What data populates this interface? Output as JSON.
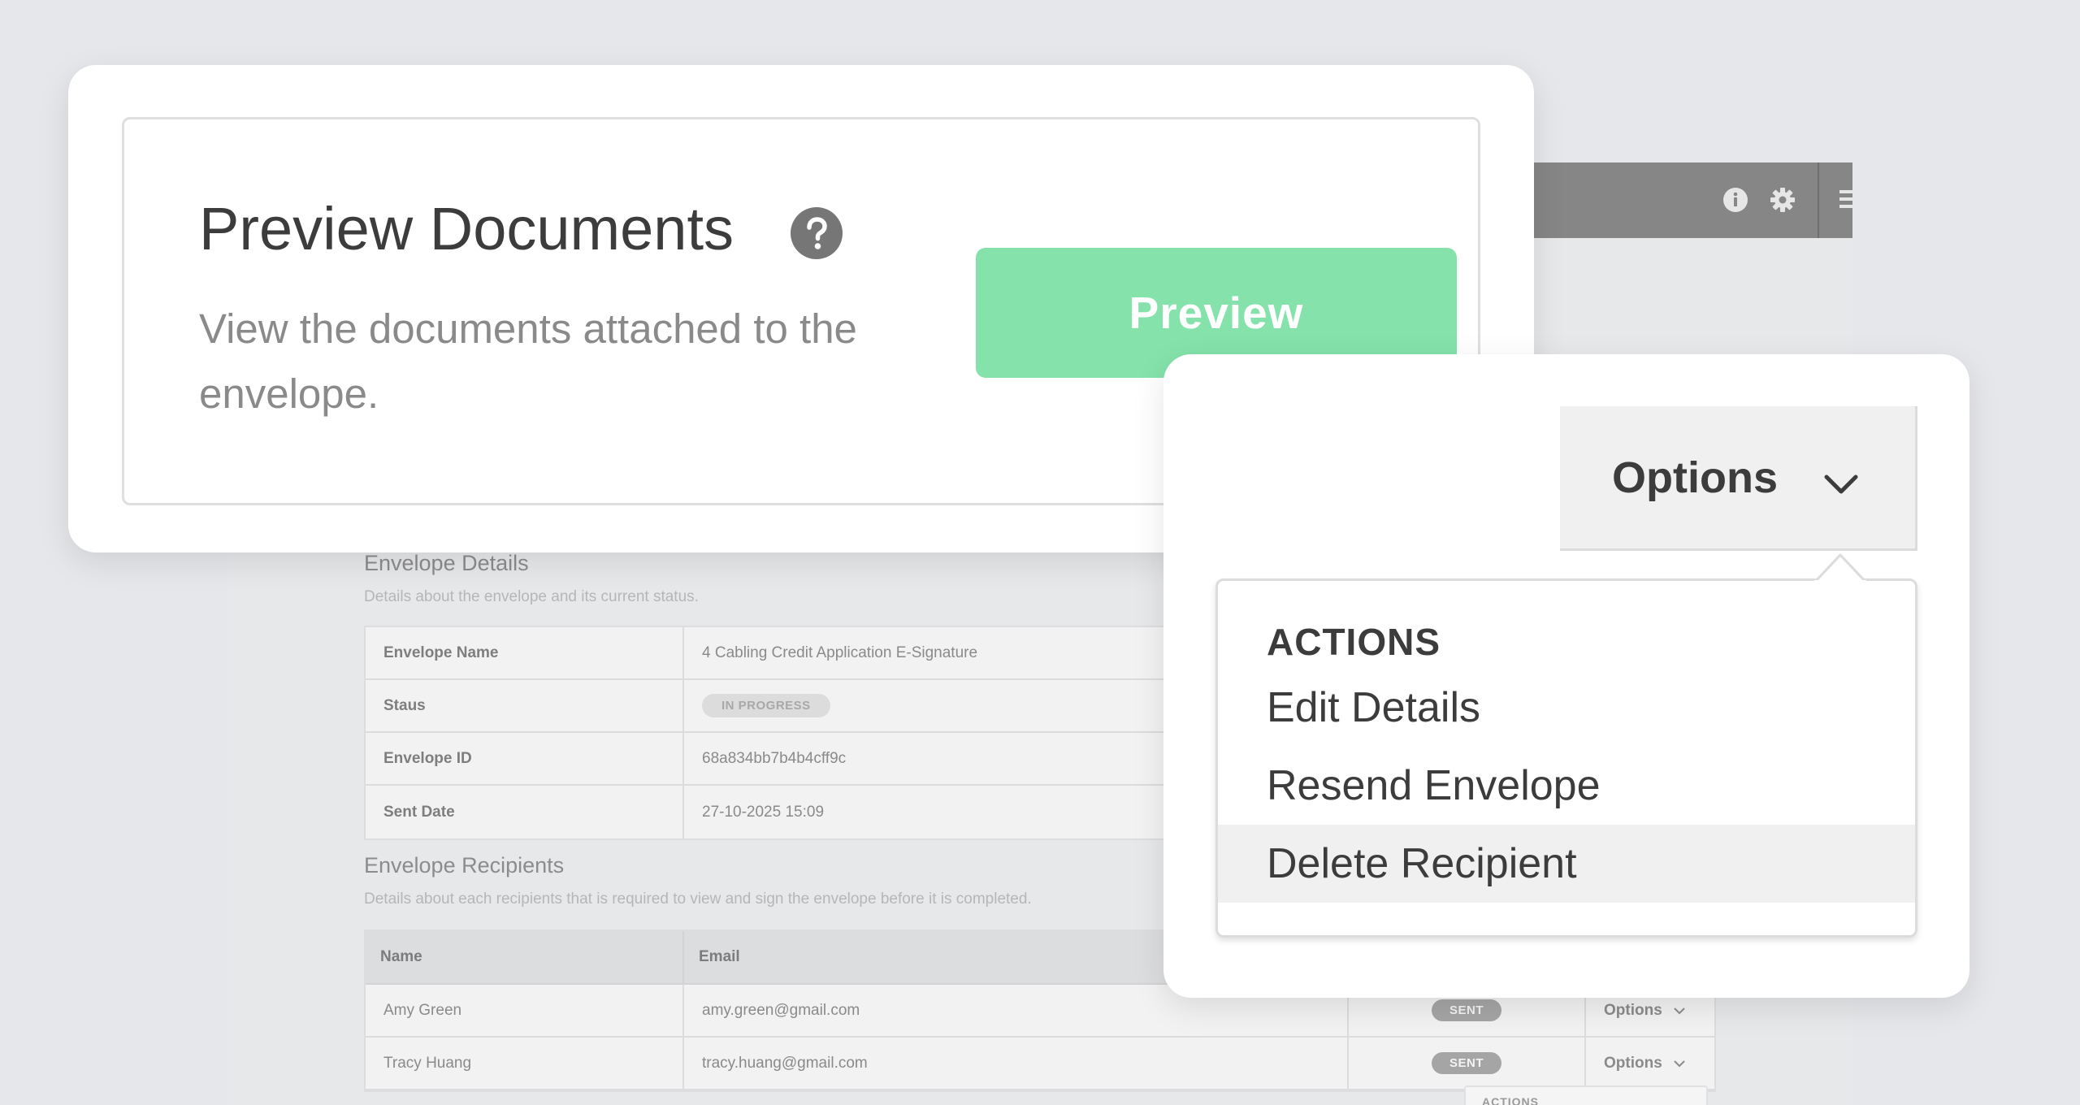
{
  "preview": {
    "title": "Preview Documents",
    "description": "View the documents attached to the envelope.",
    "button_label": "Preview"
  },
  "options": {
    "button_label": "Options",
    "menu_header": "ACTIONS",
    "items": [
      {
        "label": "Edit Details"
      },
      {
        "label": "Resend Envelope"
      },
      {
        "label": "Delete Recipient"
      }
    ]
  },
  "envelope_details": {
    "title": "Envelope Details",
    "subtitle": "Details about the envelope and its current status.",
    "rows": [
      {
        "label": "Envelope Name",
        "value": "4 Cabling Credit Application E-Signature"
      },
      {
        "label": "Staus",
        "value": "IN PROGRESS"
      },
      {
        "label": "Envelope ID",
        "value": "68a834bb7b4b4cff9c"
      },
      {
        "label": "Sent Date",
        "value": "27-10-2025 15:09"
      }
    ]
  },
  "envelope_recipients": {
    "title": "Envelope Recipients",
    "subtitle": "Details about each recipients that is required to view and sign the envelope before it is completed.",
    "headers": {
      "name": "Name",
      "email": "Email"
    },
    "rows": [
      {
        "name": "Amy Green",
        "email": "amy.green@gmail.com",
        "status": "SENT",
        "options": "Options"
      },
      {
        "name": "Tracy Huang",
        "email": "tracy.huang@gmail.com",
        "status": "SENT",
        "options": "Options"
      }
    ],
    "mini_menu_header": "ACTIONS"
  },
  "icons": {
    "help": "question-circle-icon",
    "info": "info-icon",
    "settings": "gear-icon",
    "menu": "menu-icon",
    "chevron": "chevron-down-icon"
  },
  "colors": {
    "preview_button": "#84e2aa",
    "topbar": "#868686",
    "text_dark": "#3c3c3c"
  }
}
